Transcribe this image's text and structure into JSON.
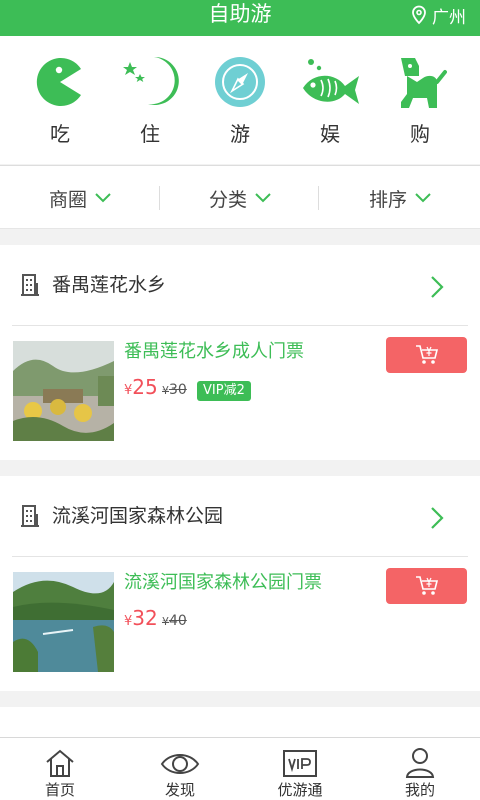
{
  "header": {
    "title": "自助游",
    "location": "广州"
  },
  "categories": [
    {
      "label": "吃",
      "icon": "pacman-icon"
    },
    {
      "label": "住",
      "icon": "moon-stars-icon"
    },
    {
      "label": "游",
      "icon": "compass-icon"
    },
    {
      "label": "娱",
      "icon": "fish-icon"
    },
    {
      "label": "购",
      "icon": "dog-icon"
    }
  ],
  "filters": [
    {
      "label": "商圈"
    },
    {
      "label": "分类"
    },
    {
      "label": "排序"
    }
  ],
  "cards": [
    {
      "merchant": "番禺莲花水乡",
      "product": "番禺莲花水乡成人门票",
      "price": "25",
      "original_price": "30",
      "currency": "¥",
      "vip_badge": "VIP减2"
    },
    {
      "merchant": "流溪河国家森林公园",
      "product": "流溪河国家森林公园门票",
      "price": "32",
      "original_price": "40",
      "currency": "¥"
    }
  ],
  "tabs": [
    {
      "label": "首页",
      "icon": "home-icon"
    },
    {
      "label": "发现",
      "icon": "eye-icon"
    },
    {
      "label": "优游通",
      "icon": "vip-card-icon"
    },
    {
      "label": "我的",
      "icon": "user-icon"
    }
  ],
  "colors": {
    "brand": "#3dbd56",
    "price": "#f2505a",
    "cart_button": "#f46466",
    "compass_bg": "#6fcfd3"
  }
}
